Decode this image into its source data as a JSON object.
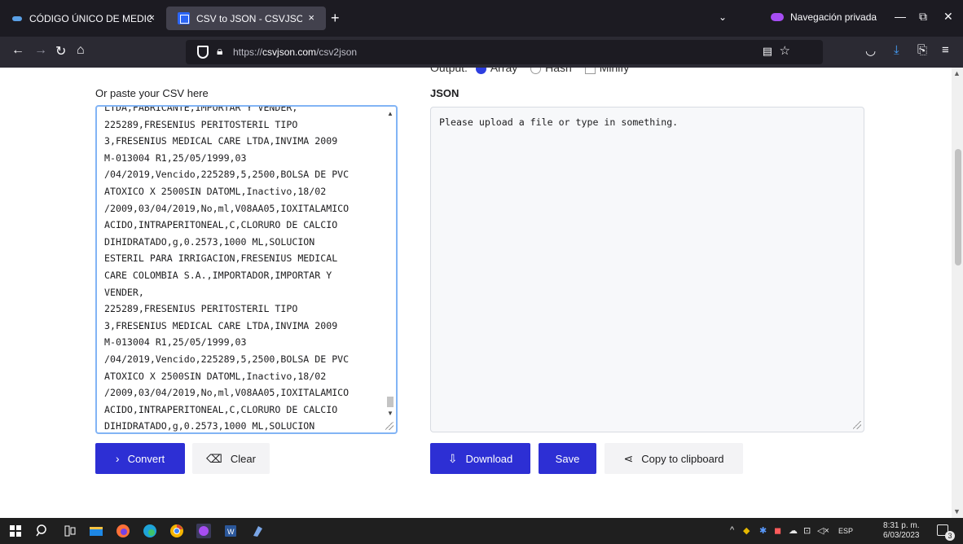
{
  "browser": {
    "tabs": [
      {
        "title": "CÓDIGO ÚNICO DE MEDICAME",
        "close": "×"
      },
      {
        "title": "CSV to JSON - CSVJSON",
        "close": "×"
      }
    ],
    "new_tab": "+",
    "list_tabs": "⌄",
    "private_label": "Navegación privada",
    "url_prefix": "https://",
    "url_domain": "csvjson.com",
    "url_path": "/csv2json"
  },
  "page": {
    "output_label": "Output:",
    "output_options": [
      "Array",
      "Hash",
      "Minify"
    ],
    "csv_label": "Or paste your CSV here",
    "json_label": "JSON",
    "csv_text": "LTDA,FABRICANTE,IMPORTAR Y VENDER,\n225289,FRESENIUS PERITOSTERIL TIPO\n3,FRESENIUS MEDICAL CARE LTDA,INVIMA 2009\nM-013004 R1,25/05/1999,03\n/04/2019,Vencido,225289,5,2500,BOLSA DE PVC\nATOXICO X 2500SIN DATOML,Inactivo,18/02\n/2009,03/04/2019,No,ml,V08AA05,IOXITALAMICO\nACIDO,INTRAPERITONEAL,C,CLORURO DE CALCIO\nDIHIDRATADO,g,0.2573,1000 ML,SOLUCION\nESTERIL PARA IRRIGACION,FRESENIUS MEDICAL\nCARE COLOMBIA S.A.,IMPORTADOR,IMPORTAR Y\nVENDER,\n225289,FRESENIUS PERITOSTERIL TIPO\n3,FRESENIUS MEDICAL CARE LTDA,INVIMA 2009\nM-013004 R1,25/05/1999,03\n/04/2019,Vencido,225289,5,2500,BOLSA DE PVC\nATOXICO X 2500SIN DATOML,Inactivo,18/02\n/2009,03/04/2019,No,ml,V08AA05,IOXITALAMICO\nACIDO,INTRAPERITONEAL,C,CLORURO DE CALCIO\nDIHIDRATADO,g,0.2573,1000 ML,SOLUCION",
    "json_text": "Please upload a file or type in something.",
    "buttons": {
      "convert": "Convert",
      "clear": "Clear",
      "download": "Download",
      "save": "Save",
      "copy": "Copy to clipboard"
    }
  },
  "taskbar": {
    "lang": "ESP",
    "time": "8:31 p. m.",
    "date": "6/03/2023",
    "notif_count": "3"
  },
  "colors": {
    "primary_button": "#2d2fd4",
    "tab_strip": "#1c1b22",
    "private_accent": "#a64df3"
  }
}
